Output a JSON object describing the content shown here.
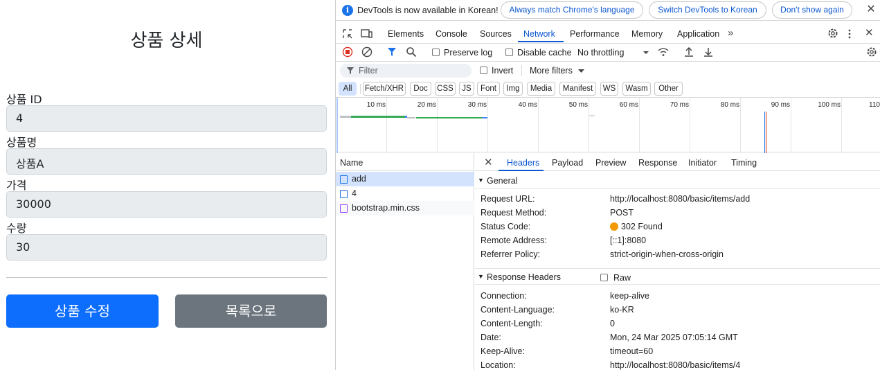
{
  "page": {
    "title": "상품 상세",
    "fields": [
      {
        "label": "상품 ID",
        "value": "4"
      },
      {
        "label": "상품명",
        "value": "상품A"
      },
      {
        "label": "가격",
        "value": "30000"
      },
      {
        "label": "수량",
        "value": "30"
      }
    ],
    "edit_button": "상품 수정",
    "list_button": "목록으로"
  },
  "devtools": {
    "infobar": {
      "text": "DevTools is now available in Korean!",
      "btn_match": "Always match Chrome's language",
      "btn_switch": "Switch DevTools to Korean",
      "btn_dont": "Don't show again",
      "close": "✕"
    },
    "tabs": [
      "Elements",
      "Console",
      "Sources",
      "Network",
      "Performance",
      "Memory",
      "Application"
    ],
    "toolbar": {
      "preserve_log": "Preserve log",
      "disable_cache": "Disable cache",
      "throttling": "No throttling"
    },
    "filter": {
      "placeholder": "Filter",
      "invert": "Invert",
      "more_filters": "More filters"
    },
    "type_filters": [
      "All",
      "Fetch/XHR",
      "Doc",
      "CSS",
      "JS",
      "Font",
      "Img",
      "Media",
      "Manifest",
      "WS",
      "Wasm",
      "Other"
    ],
    "timeline_ticks": [
      "10 ms",
      "20 ms",
      "30 ms",
      "40 ms",
      "50 ms",
      "60 ms",
      "70 ms",
      "80 ms",
      "90 ms",
      "100 ms",
      "110"
    ],
    "requests": {
      "column": "Name",
      "rows": [
        "add",
        "4",
        "bootstrap.min.css"
      ]
    },
    "detail": {
      "close": "✕",
      "tabs": [
        "Headers",
        "Payload",
        "Preview",
        "Response",
        "Initiator",
        "Timing"
      ],
      "general_title": "General",
      "general": [
        {
          "k": "Request URL:",
          "v": "http://localhost:8080/basic/items/add"
        },
        {
          "k": "Request Method:",
          "v": "POST"
        },
        {
          "k": "Status Code:",
          "v": "302 Found"
        },
        {
          "k": "Remote Address:",
          "v": "[::1]:8080"
        },
        {
          "k": "Referrer Policy:",
          "v": "strict-origin-when-cross-origin"
        }
      ],
      "response_title": "Response Headers",
      "raw": "Raw",
      "response": [
        {
          "k": "Connection:",
          "v": "keep-alive"
        },
        {
          "k": "Content-Language:",
          "v": "ko-KR"
        },
        {
          "k": "Content-Length:",
          "v": "0"
        },
        {
          "k": "Date:",
          "v": "Mon, 24 Mar 2025 07:05:14 GMT"
        },
        {
          "k": "Keep-Alive:",
          "v": "timeout=60"
        },
        {
          "k": "Location:",
          "v": "http://localhost:8080/basic/items/4"
        }
      ]
    },
    "colors": {
      "accent": "#0b57d0",
      "record": "#d93025",
      "status_warning": "#f29900"
    }
  }
}
